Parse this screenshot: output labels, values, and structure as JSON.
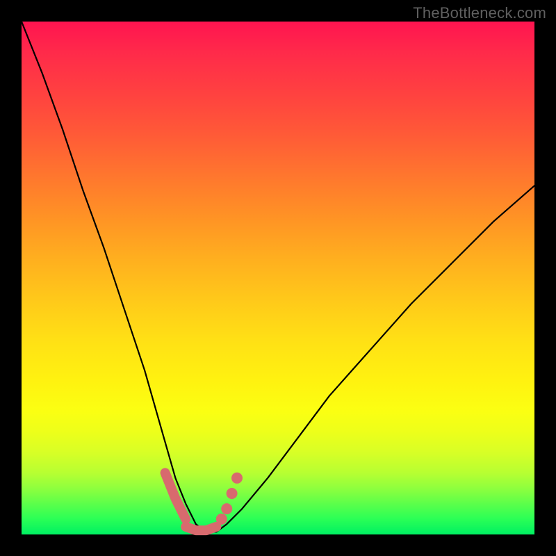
{
  "watermark": "TheBottleneck.com",
  "colors": {
    "gradient_top": "#ff1450",
    "gradient_mid": "#fff210",
    "gradient_bottom": "#00f062",
    "curve": "#000000",
    "markers": "#d86a6e",
    "page_bg": "#000000"
  },
  "chart_data": {
    "type": "line",
    "title": "",
    "xlabel": "",
    "ylabel": "",
    "xlim": [
      0,
      100
    ],
    "ylim": [
      0,
      100
    ],
    "grid": false,
    "legend": false,
    "note": "Bottleneck-style curve: y ≈ 100 at x=0, dips to ~0 near x≈35, rises toward ~68 at x=100. Vertical background encodes y-value (red=high, green=low). Salmon markers highlight the valley region where the curve is near zero.",
    "series": [
      {
        "name": "bottleneck_curve",
        "x": [
          0,
          4,
          8,
          12,
          16,
          20,
          24,
          28,
          30,
          32,
          34,
          36,
          38,
          40,
          43,
          48,
          54,
          60,
          68,
          76,
          84,
          92,
          100
        ],
        "y": [
          100,
          90,
          79,
          67,
          56,
          44,
          32,
          18,
          11,
          6,
          2,
          0.5,
          0.5,
          2,
          5,
          11,
          19,
          27,
          36,
          45,
          53,
          61,
          68
        ]
      }
    ],
    "highlight_markers": {
      "description": "Salmon segment and dots marking the valley (approx x in [28,42], y ≤ ~12).",
      "left_segment": {
        "x": [
          28,
          30,
          32
        ],
        "y": [
          12,
          7,
          3
        ]
      },
      "floor_segment": {
        "x": [
          32,
          34,
          36,
          38
        ],
        "y": [
          1.5,
          0.8,
          0.8,
          1.5
        ]
      },
      "right_dots": {
        "x": [
          39,
          40,
          41,
          42
        ],
        "y": [
          3,
          5,
          8,
          11
        ]
      }
    }
  }
}
